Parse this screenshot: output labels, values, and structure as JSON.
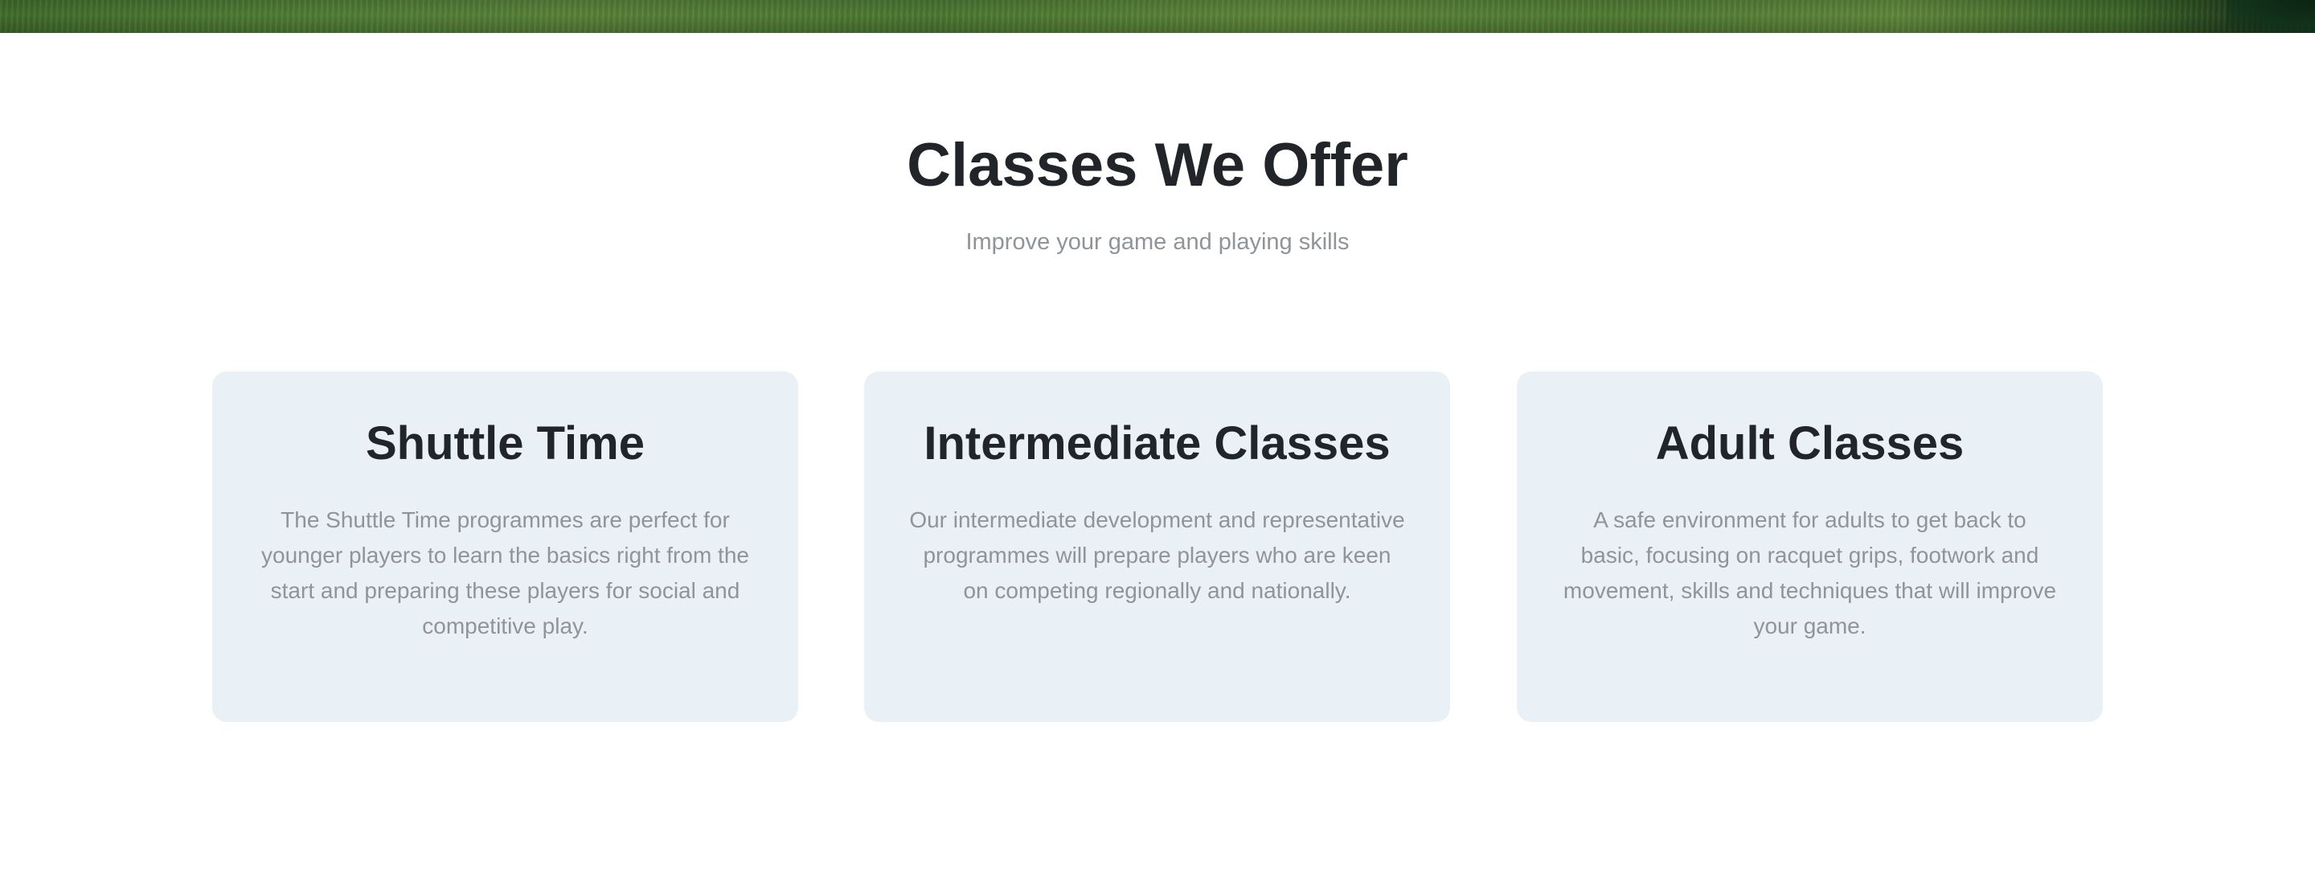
{
  "section": {
    "title": "Classes We Offer",
    "subtitle": "Improve your game and playing skills"
  },
  "cards": [
    {
      "title": "Shuttle Time",
      "text": "The Shuttle Time programmes are perfect for younger players to learn the basics right from the start and preparing these players for social and competitive play."
    },
    {
      "title": "Intermediate Classes",
      "text": "Our intermediate development and representative programmes will prepare players who are keen on competing regionally and nationally."
    },
    {
      "title": "Adult Classes",
      "text": "A safe environment for adults to get back to basic, focusing on racquet grips, footwork and movement, skills and techniques that will improve your game."
    }
  ]
}
